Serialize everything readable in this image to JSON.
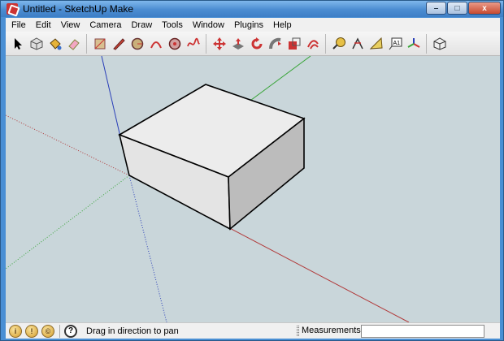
{
  "window": {
    "title": "Untitled - SketchUp Make",
    "controls": {
      "minimize": "–",
      "maximize": "□",
      "close": "x"
    }
  },
  "menu": [
    "File",
    "Edit",
    "View",
    "Camera",
    "Draw",
    "Tools",
    "Window",
    "Plugins",
    "Help"
  ],
  "toolbar": {
    "tools": [
      {
        "name": "select-tool",
        "icon": "arrow-cursor-icon"
      },
      {
        "name": "make-component-tool",
        "icon": "component-icon"
      },
      {
        "name": "paint-bucket-tool",
        "icon": "paint-bucket-icon"
      },
      {
        "name": "eraser-tool",
        "icon": "eraser-icon"
      },
      {
        "name": "rectangle-tool",
        "icon": "rectangle-icon"
      },
      {
        "name": "line-tool",
        "icon": "pencil-icon"
      },
      {
        "name": "circle-tool",
        "icon": "circle-icon"
      },
      {
        "name": "arc-tool",
        "icon": "arc-icon"
      },
      {
        "name": "polygon-tool",
        "icon": "polygon-icon"
      },
      {
        "name": "freehand-tool",
        "icon": "freehand-icon"
      },
      {
        "name": "move-tool",
        "icon": "move-icon"
      },
      {
        "name": "push-pull-tool",
        "icon": "push-pull-icon"
      },
      {
        "name": "rotate-tool",
        "icon": "rotate-icon"
      },
      {
        "name": "follow-me-tool",
        "icon": "follow-me-icon"
      },
      {
        "name": "scale-tool",
        "icon": "scale-icon"
      },
      {
        "name": "offset-tool",
        "icon": "offset-icon"
      },
      {
        "name": "tape-measure-tool",
        "icon": "tape-measure-icon"
      },
      {
        "name": "dimension-tool",
        "icon": "dimension-icon"
      },
      {
        "name": "protractor-tool",
        "icon": "protractor-icon"
      },
      {
        "name": "text-tool",
        "icon": "text-label-icon"
      },
      {
        "name": "axes-tool",
        "icon": "axes-icon"
      },
      {
        "name": "3d-text-tool",
        "icon": "3d-text-icon"
      }
    ],
    "text_tool_label": "A1"
  },
  "statusbar": {
    "geo_icons": [
      "i",
      "!",
      "©"
    ],
    "help_label": "?",
    "message": "Drag in direction to pan",
    "measurements_label": "Measurements",
    "measurements_value": ""
  },
  "colors": {
    "viewport_bg": "#c9d6da",
    "red_axis": "#b13a3a",
    "green_axis": "#3aa53a",
    "blue_axis": "#2a3fb8",
    "box_top": "#ececec",
    "box_front": "#e6e6e6",
    "box_side": "#bcbcbc"
  }
}
